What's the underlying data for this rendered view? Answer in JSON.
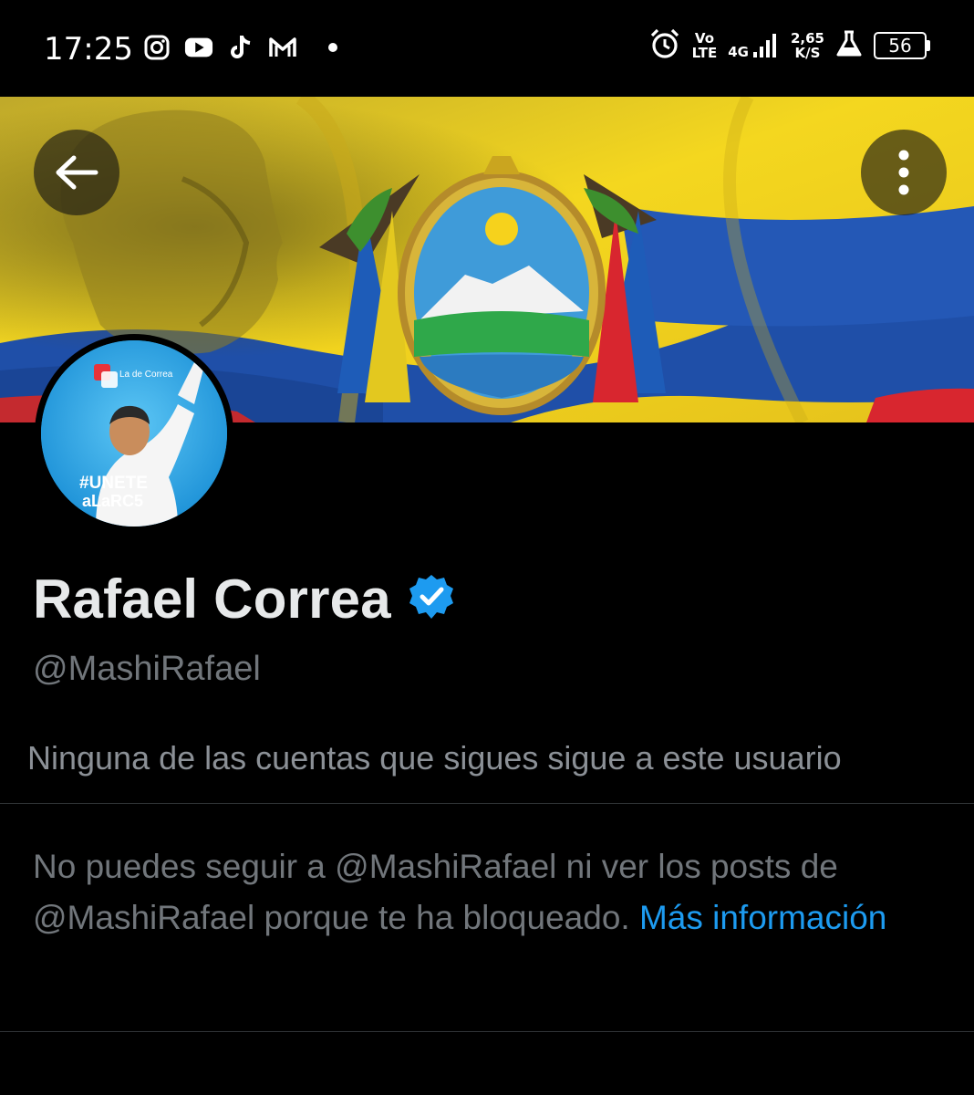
{
  "status_bar": {
    "time": "17:25",
    "left_icons": [
      "instagram-icon",
      "youtube-icon",
      "tiktok-icon",
      "gmail-icon",
      "dot-icon"
    ],
    "network_top": "Vo",
    "network_bottom": "LTE",
    "signal_label": "4G",
    "speed_top": "2,65",
    "speed_bottom": "K/S",
    "battery": "56"
  },
  "profile": {
    "name": "Rafael Correa",
    "handle": "@MashiRafael",
    "follows_info": "Ninguna de las cuentas que sigues sigue a este usuario",
    "avatar_text_brand": "La de Correa",
    "avatar_text_tag_1": "#UNETE",
    "avatar_text_tag_2": "aLaRC5"
  },
  "blocked_notice": {
    "text": "No puedes seguir a @MashiRafael ni ver los posts de @MashiRafael porque te ha bloqueado. ",
    "link": "Más información"
  },
  "colors": {
    "background": "#000000",
    "text_primary": "#e7e9ea",
    "text_secondary": "#71767b",
    "link": "#1d9bf0",
    "verified": "#1d9bf0",
    "flag_yellow": "#f2d41c",
    "flag_blue": "#1f4fa8",
    "flag_red": "#d8262f"
  }
}
